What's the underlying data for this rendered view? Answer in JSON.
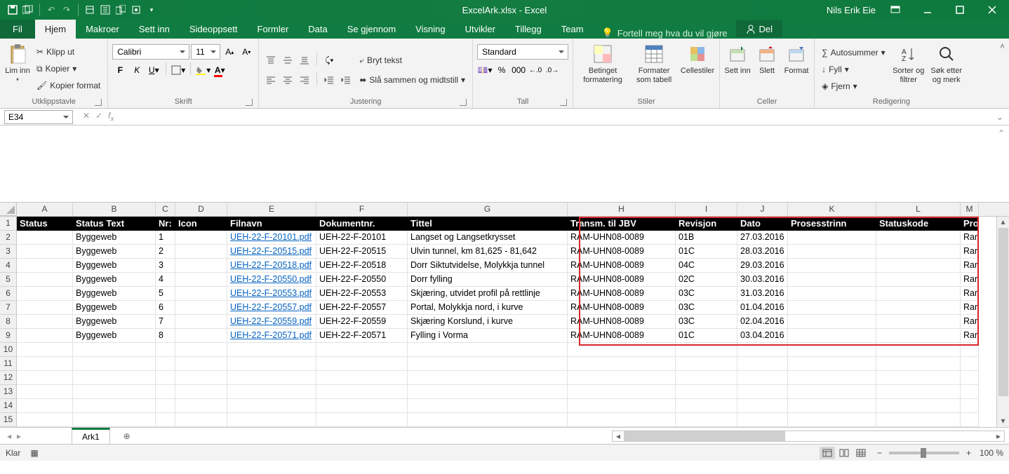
{
  "app": {
    "title": "ExcelArk.xlsx - Excel",
    "user": "Nils Erik Eie"
  },
  "tabs": {
    "file": "Fil",
    "home": "Hjem",
    "makroer": "Makroer",
    "settinn": "Sett inn",
    "sideoppsett": "Sideoppsett",
    "formler": "Formler",
    "data": "Data",
    "segjennom": "Se gjennom",
    "visning": "Visning",
    "utvikler": "Utvikler",
    "tillegg": "Tillegg",
    "team": "Team",
    "tell": "Fortell meg hva du vil gjøre",
    "share": "Del"
  },
  "ribbon": {
    "clipboard": {
      "paste": "Lim inn",
      "cut": "Klipp ut",
      "copy": "Kopier",
      "painter": "Kopier format",
      "label": "Utklippstavle"
    },
    "font": {
      "name": "Calibri",
      "size": "11",
      "label": "Skrift"
    },
    "align": {
      "wrap": "Bryt tekst",
      "merge": "Slå sammen og midtstill",
      "label": "Justering"
    },
    "number": {
      "format": "Standard",
      "label": "Tall"
    },
    "styles": {
      "cond": "Betinget formatering",
      "table": "Formater som tabell",
      "cellstyles": "Cellestiler",
      "label": "Stiler"
    },
    "cells": {
      "insert": "Sett inn",
      "delete": "Slett",
      "format": "Format",
      "label": "Celler"
    },
    "editing": {
      "sum": "Autosummer",
      "fill": "Fyll",
      "clear": "Fjern",
      "sort": "Sorter og filtrer",
      "find": "Søk etter og merk",
      "label": "Redigering"
    }
  },
  "namebox": "E34",
  "columns": [
    "A",
    "B",
    "C",
    "D",
    "E",
    "F",
    "G",
    "H",
    "I",
    "J",
    "K",
    "L",
    "M"
  ],
  "headers": [
    "Status",
    "Status Text",
    "Nr:",
    "Icon",
    "Filnavn",
    "Dokumentnr.",
    "Tittel",
    "Transm. til JBV",
    "Revisjon",
    "Dato",
    "Prosesstrinn",
    "Statuskode",
    "Pro"
  ],
  "data_rows": [
    {
      "status": "",
      "statustext": "Byggeweb",
      "nr": "1",
      "icon": "",
      "filnavn": "UEH-22-F-20101.pdf",
      "doknr": "UEH-22-F-20101",
      "tittel": "Langset og Langsetkrysset",
      "transm": "RAM-UHN08-0089",
      "rev": "01B",
      "dato": "27.03.2016",
      "pros": "",
      "skode": "",
      "pro": "Ramb"
    },
    {
      "status": "",
      "statustext": "Byggeweb",
      "nr": "2",
      "icon": "",
      "filnavn": "UEH-22-F-20515.pdf",
      "doknr": "UEH-22-F-20515",
      "tittel": "Ulvin tunnel, km 81,625 - 81,642",
      "transm": "RAM-UHN08-0089",
      "rev": "01C",
      "dato": "28.03.2016",
      "pros": "",
      "skode": "",
      "pro": "Ramb"
    },
    {
      "status": "",
      "statustext": "Byggeweb",
      "nr": "3",
      "icon": "",
      "filnavn": "UEH-22-F-20518.pdf",
      "doknr": "UEH-22-F-20518",
      "tittel": "Dorr Siktutvidelse, Molykkja tunnel",
      "transm": "RAM-UHN08-0089",
      "rev": "04C",
      "dato": "29.03.2016",
      "pros": "",
      "skode": "",
      "pro": "Ramb"
    },
    {
      "status": "",
      "statustext": "Byggeweb",
      "nr": "4",
      "icon": "",
      "filnavn": "UEH-22-F-20550.pdf",
      "doknr": "UEH-22-F-20550",
      "tittel": "Dorr fylling",
      "transm": "RAM-UHN08-0089",
      "rev": "02C",
      "dato": "30.03.2016",
      "pros": "",
      "skode": "",
      "pro": "Ramb"
    },
    {
      "status": "",
      "statustext": "Byggeweb",
      "nr": "5",
      "icon": "",
      "filnavn": "UEH-22-F-20553.pdf",
      "doknr": "UEH-22-F-20553",
      "tittel": "Skjæring, utvidet profil på rettlinje",
      "transm": "RAM-UHN08-0089",
      "rev": "03C",
      "dato": "31.03.2016",
      "pros": "",
      "skode": "",
      "pro": "Ramb"
    },
    {
      "status": "",
      "statustext": "Byggeweb",
      "nr": "6",
      "icon": "",
      "filnavn": "UEH-22-F-20557.pdf",
      "doknr": "UEH-22-F-20557",
      "tittel": "Portal, Molykkja nord, i kurve",
      "transm": "RAM-UHN08-0089",
      "rev": "03C",
      "dato": "01.04.2016",
      "pros": "",
      "skode": "",
      "pro": "Ramb"
    },
    {
      "status": "",
      "statustext": "Byggeweb",
      "nr": "7",
      "icon": "",
      "filnavn": "UEH-22-F-20559.pdf",
      "doknr": "UEH-22-F-20559",
      "tittel": "Skjæring Korslund, i kurve",
      "transm": "RAM-UHN08-0089",
      "rev": "03C",
      "dato": "02.04.2016",
      "pros": "",
      "skode": "",
      "pro": "Ramb"
    },
    {
      "status": "",
      "statustext": "Byggeweb",
      "nr": "8",
      "icon": "",
      "filnavn": "UEH-22-F-20571.pdf",
      "doknr": "UEH-22-F-20571",
      "tittel": "Fylling i Vorma",
      "transm": "RAM-UHN08-0089",
      "rev": "01C",
      "dato": "03.04.2016",
      "pros": "",
      "skode": "",
      "pro": "Ramb"
    }
  ],
  "sheet": {
    "active": "Ark1"
  },
  "status": {
    "ready": "Klar",
    "zoom": "100 %"
  }
}
